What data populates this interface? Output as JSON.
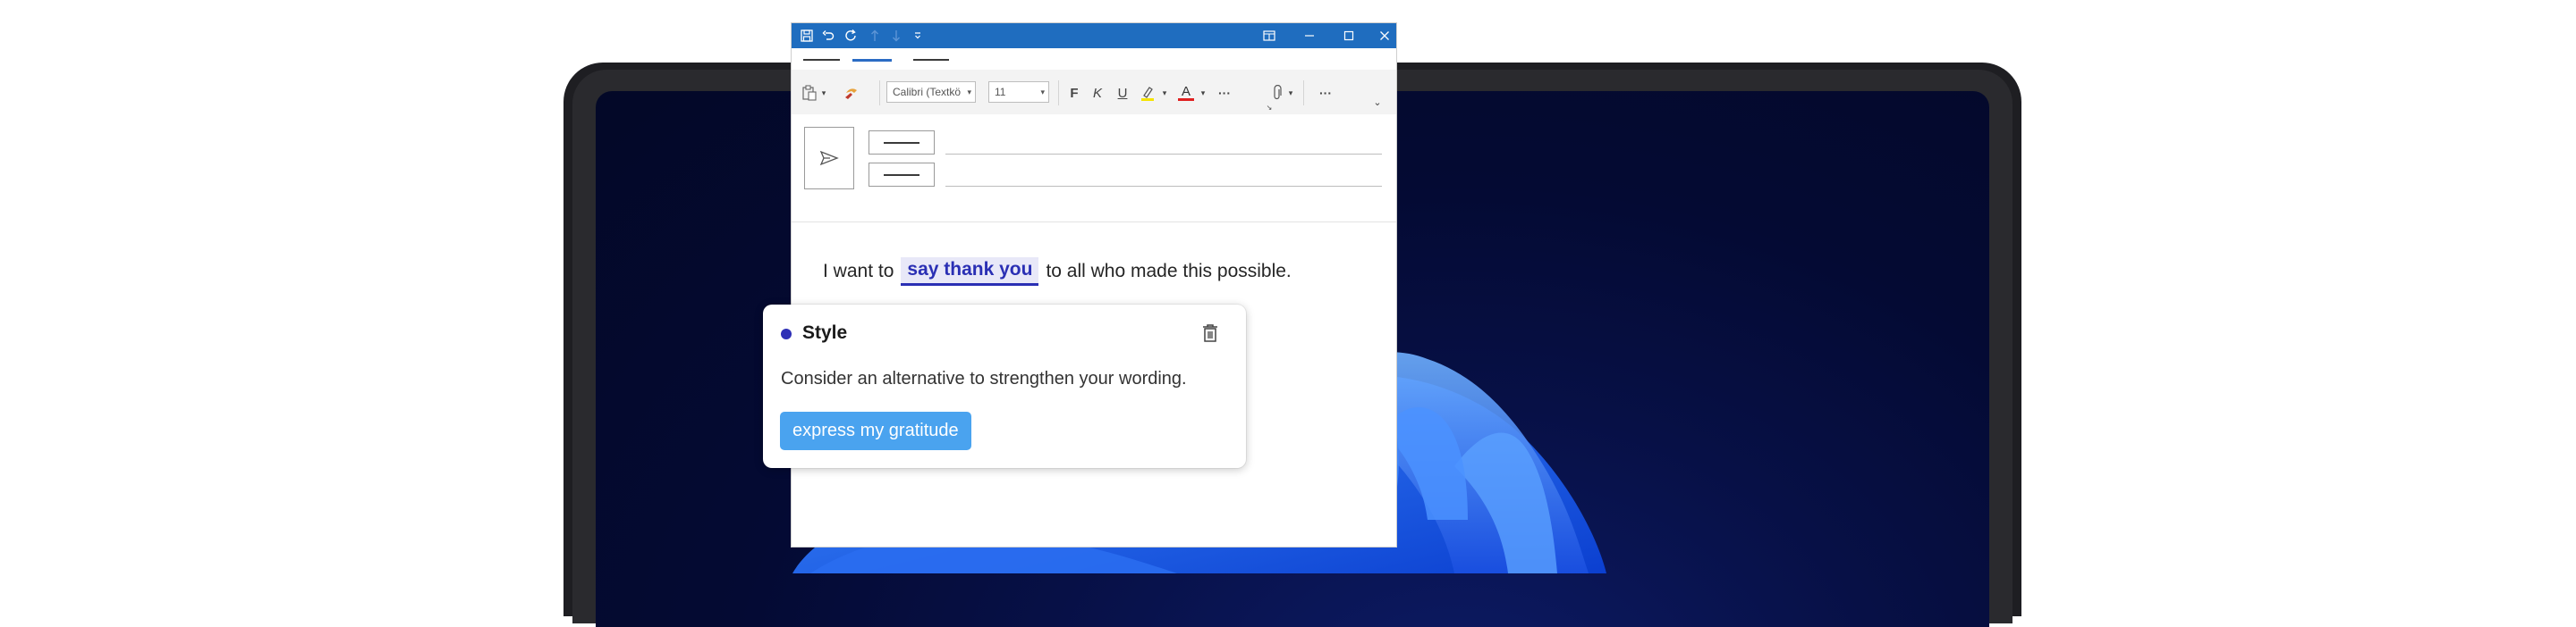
{
  "window": {
    "titlebar_icons": [
      "save-icon",
      "undo-icon",
      "redo-icon",
      "arrow-up-icon",
      "arrow-down-icon",
      "customize-quick-access-icon"
    ],
    "window_controls": [
      "ribbon-display-options-icon",
      "minimize-icon",
      "maximize-icon",
      "close-icon"
    ],
    "accent_color": "#1f6dbf"
  },
  "ribbon": {
    "font_name": "Calibri (Textkö",
    "font_size": "11",
    "bold_label": "F",
    "italic_label": "K",
    "underline_label": "U",
    "font_color_label": "A",
    "more_label": "···",
    "more_label_2": "···"
  },
  "email": {
    "text_before": "I want to",
    "highlight": "say thank you",
    "text_after": "to all who made this possible."
  },
  "suggestion": {
    "category": "Style",
    "message": "Consider an alternative to strengthen your wording.",
    "action": "express my gratitude",
    "dot_color": "#2e2fb6",
    "action_color": "#4aa3ef"
  }
}
